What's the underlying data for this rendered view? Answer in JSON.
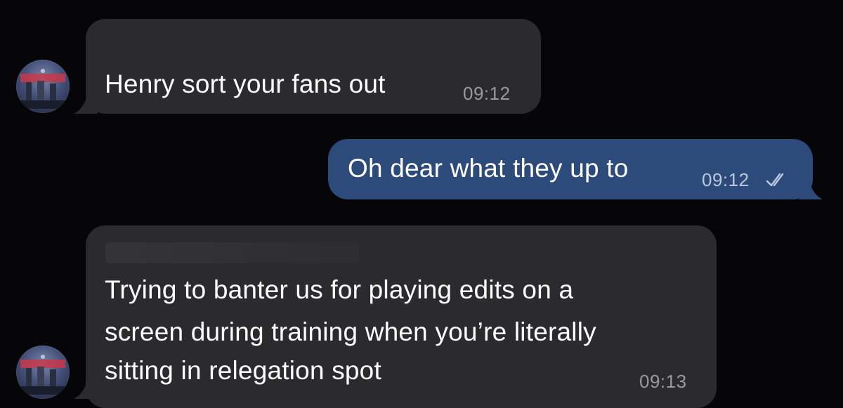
{
  "chat": {
    "messages": [
      {
        "direction": "incoming",
        "text": "Henry sort your fans out",
        "time": "09:12",
        "avatar_icon": "profile-photo-icon"
      },
      {
        "direction": "outgoing",
        "text": "Oh dear what they up to",
        "time": "09:12",
        "status_icon": "double-check-icon",
        "status": "read"
      },
      {
        "direction": "incoming",
        "lines": [
          "Trying to banter us for playing edits on a",
          "screen during training when you’re literally",
          "sitting in relegation spot"
        ],
        "time": "09:13",
        "avatar_icon": "profile-photo-icon"
      }
    ]
  },
  "colors": {
    "background": "#060608",
    "incoming_bubble": "#2b2b2d",
    "outgoing_bubble": "#2c4a7a",
    "timestamp": "#9a9a9e"
  }
}
